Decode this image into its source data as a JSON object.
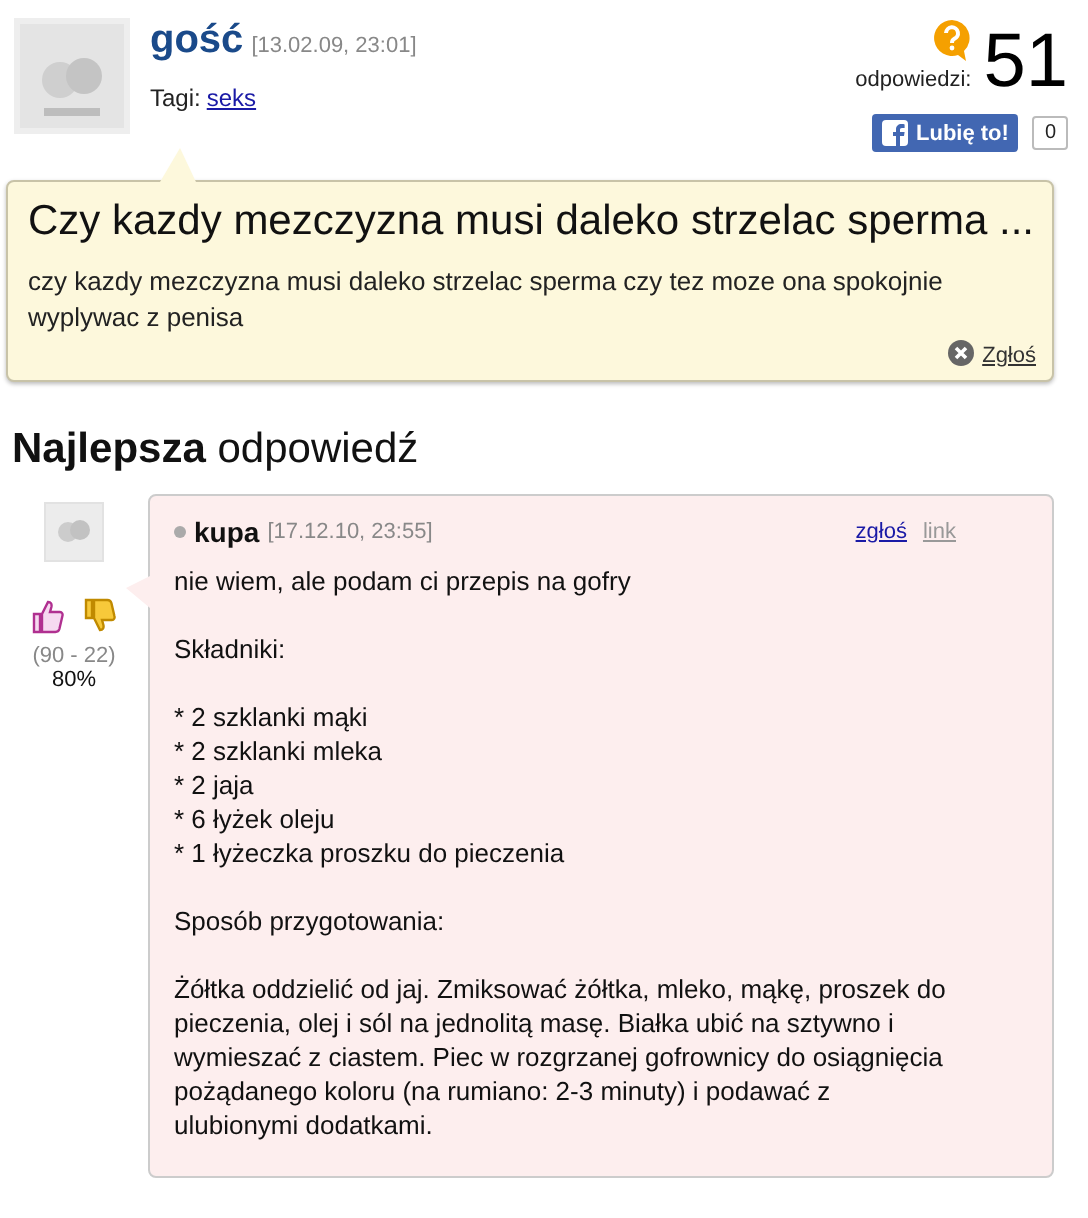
{
  "question": {
    "author": "gość",
    "date": "[13.02.09, 23:01]",
    "tags_label": "Tagi:",
    "tags": [
      "seks"
    ],
    "answers_label": "odpowiedzi:",
    "answers_count": "51",
    "like_button": "Lubię to!",
    "like_count": "0",
    "title": "Czy kazdy mezczyzna musi daleko strzelac sperma ...",
    "body": "czy kazdy mezczyzna musi daleko strzelac sperma czy tez moze ona spokojnie wyplywac z penisa",
    "report": "Zgłoś"
  },
  "best_heading": "**Najlepsza** odpowiedź",
  "best_answer": {
    "votes": "(90 - 22)",
    "percent": "80%",
    "author": "kupa",
    "date": "[17.12.10, 23:55]",
    "actions": [
      "zgłoś",
      "link"
    ],
    "paragraphs": [
      [
        "nie wiem, ale podam ci przepis na gofry"
      ],
      [
        "Składniki:"
      ],
      [
        "* 2 szklanki mąki",
        "* 2 szklanki mleka",
        "* 2 jaja",
        "* 6 łyżek oleju",
        "* 1 łyżeczka proszku do pieczenia"
      ],
      [
        "Sposób przygotowania:"
      ],
      [
        "Żółtka oddzielić od jaj. Zmiksować żółtka, mleko, mąkę, proszek do pieczenia, olej i sól na jednolitą masę. Białka ubić na sztywno i wymieszać z ciastem. Piec w rozgrzanej gofrownicy do osiągnięcia pożądanego koloru (na rumiano: 2-3 minuty) i podawać z ulubionymi dodatkami."
      ]
    ]
  }
}
